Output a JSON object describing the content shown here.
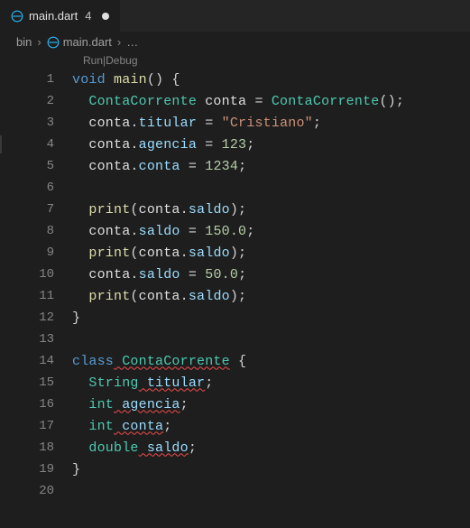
{
  "tab": {
    "filename": "main.dart",
    "problem_count": "4"
  },
  "breadcrumb": {
    "folder": "bin",
    "file": "main.dart",
    "more": "…"
  },
  "codelens": {
    "run": "Run",
    "debug": "Debug",
    "sep": " | "
  },
  "code": {
    "l1": {
      "kw": "void",
      "fn": "main",
      "par": "() {",
      "num": "1"
    },
    "l2": {
      "type1": "ContaCorrente",
      "v": " conta ",
      "eq": "=",
      "type2": " ContaCorrente",
      "tail": "();",
      "num": "2"
    },
    "l3": {
      "obj": "conta",
      "dot": ".",
      "prop": "titular",
      "eq": " = ",
      "str": "\"Cristiano\"",
      "semi": ";",
      "num": "3"
    },
    "l4": {
      "obj": "conta",
      "dot": ".",
      "prop": "agencia",
      "eq": " = ",
      "val": "123",
      "semi": ";",
      "num": "4"
    },
    "l5": {
      "obj": "conta",
      "dot": ".",
      "prop": "conta",
      "eq": " = ",
      "val": "1234",
      "semi": ";",
      "num": "5"
    },
    "l6": {
      "num": "6"
    },
    "l7": {
      "fn": "print",
      "open": "(",
      "obj": "conta",
      "dot": ".",
      "prop": "saldo",
      "close": ");",
      "num": "7"
    },
    "l8": {
      "obj": "conta",
      "dot": ".",
      "prop": "saldo",
      "eq": " = ",
      "val": "150.0",
      "semi": ";",
      "num": "8"
    },
    "l9": {
      "fn": "print",
      "open": "(",
      "obj": "conta",
      "dot": ".",
      "prop": "saldo",
      "close": ");",
      "num": "9"
    },
    "l10": {
      "obj": "conta",
      "dot": ".",
      "prop": "saldo",
      "eq": " = ",
      "val": "50.0",
      "semi": ";",
      "num": "10"
    },
    "l11": {
      "fn": "print",
      "open": "(",
      "obj": "conta",
      "dot": ".",
      "prop": "saldo",
      "close": ");",
      "num": "11"
    },
    "l12": {
      "brace": "}",
      "num": "12"
    },
    "l13": {
      "num": "13"
    },
    "l14": {
      "kw": "class",
      "type": " ContaCorrente",
      "brace": " {",
      "num": "14"
    },
    "l15": {
      "type": "String",
      "name": " titular",
      "semi": ";",
      "num": "15"
    },
    "l16": {
      "type": "int",
      "name": " agencia",
      "semi": ";",
      "num": "16"
    },
    "l17": {
      "type": "int",
      "name": " conta",
      "semi": ";",
      "num": "17"
    },
    "l18": {
      "type": "double",
      "name": " saldo",
      "semi": ";",
      "num": "18"
    },
    "l19": {
      "brace": "}",
      "num": "19"
    },
    "l20": {
      "num": "20"
    }
  }
}
